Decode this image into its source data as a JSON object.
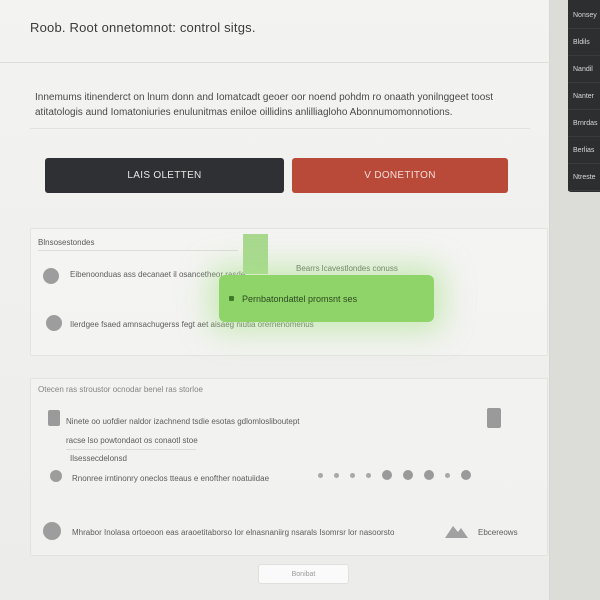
{
  "header": {
    "title": "Roob. Root onnetomnot: control sitgs."
  },
  "intro": {
    "line1": "Innemums itinenderct on lnum donn and Iomatcadt geoer oor noend pohdm ro onaath yonilnggeet toost",
    "line2": "atitatologis aund Iomatoniuries enulunitmas eniloe oillidins anlilliagloho Abonnumomonnotions."
  },
  "buttons": {
    "primary": "LAIS  OLETTEN",
    "danger": "V  DONETITON"
  },
  "side_menu": [
    "Nonsey",
    "Bldils",
    "Nandil",
    "Nanter",
    "Brnrdas",
    "Berlias",
    "Ntreste"
  ],
  "section1": {
    "label": "Blnsosestondes",
    "row1": "Eibenoonduas ass decanaet il osancetheor rasde",
    "row1_right": "Bearrs lcavestlondes conuss",
    "row2": "Ilerdgee fsaed amnsachugerss fegt aet aisaeg niutia orernenomenus"
  },
  "toast": {
    "text": "Pernbatondattel promsnt ses"
  },
  "section2": {
    "label": "Otecen ras stroustor ocnodar benel ras storloe",
    "row1": "Ninete oo uofdier naldor izachnend tsdie esotas gdlomlosliboutept",
    "row2": "racse lso powtondaot os conaotl stoe",
    "row3": "Ilsessecdelonsd",
    "row4": "Rnonree irntinonry oneclos tteaus e enofther noatuiidae",
    "row5": "Mhrabor Inolasa ortoeoon eas araoetitaborso Ior elnasnaniirg nsarals Isomrsr lor nasoorsto",
    "row5_right": "Ebcereows"
  },
  "footer": {
    "button": "Bonibat"
  }
}
